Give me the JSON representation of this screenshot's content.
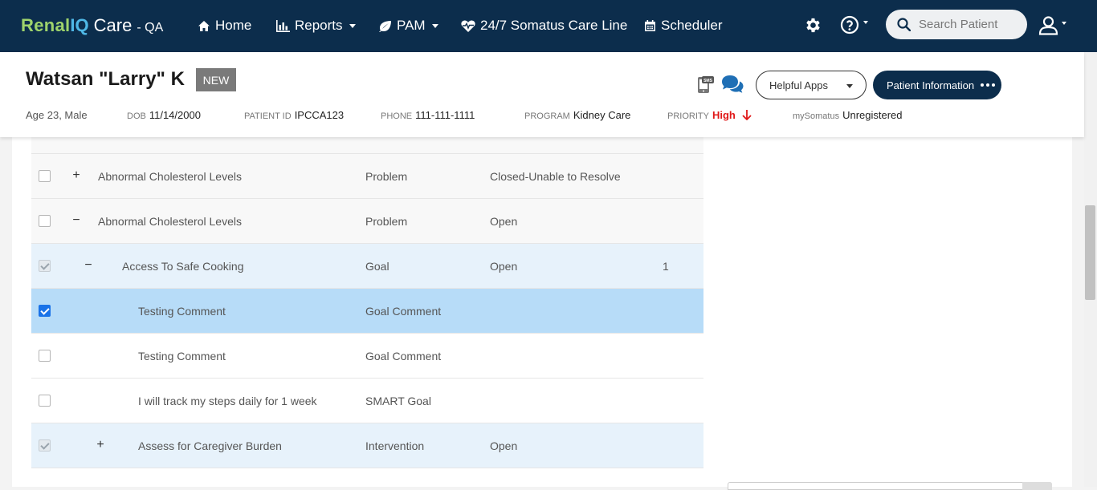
{
  "brand": {
    "renal": "Renal",
    "iq": "IQ",
    "care": "Care",
    "env": "- QA"
  },
  "nav": {
    "home": "Home",
    "reports": "Reports",
    "pam": "PAM",
    "careline": "24/7 Somatus Care Line",
    "scheduler": "Scheduler"
  },
  "search": {
    "placeholder": "Search Patient"
  },
  "patient": {
    "name": "Watsan \"Larry\" K",
    "badge": "NEW",
    "age": "Age 23, Male",
    "dob_label": "DOB",
    "dob": "11/14/2000",
    "id_label": "PATIENT ID",
    "id": "IPCCA123",
    "phone_label": "PHONE",
    "phone": "111-111-1111",
    "program_label": "PROGRAM",
    "program": "Kidney Care",
    "priority_label": "PRIORITY",
    "priority": "High",
    "mysomatus_label": "mySomatus",
    "mysomatus": "Unregistered"
  },
  "actions": {
    "helpful_apps": "Helpful Apps",
    "patient_info": "Patient Information"
  },
  "rows": [
    {
      "name": "Abnormal Cholesterol Levels",
      "type": "Problem",
      "status": "Closed-Unable to Resolve",
      "count": ""
    },
    {
      "name": "Abnormal Cholesterol Levels",
      "type": "Problem",
      "status": "Open",
      "count": ""
    },
    {
      "name": "Access To Safe Cooking",
      "type": "Goal",
      "status": "Open",
      "count": "1"
    },
    {
      "name": "Testing Comment",
      "type": "Goal Comment",
      "status": "",
      "count": ""
    },
    {
      "name": "Testing Comment",
      "type": "Goal Comment",
      "status": "",
      "count": ""
    },
    {
      "name": "I will track my steps daily for 1 week",
      "type": "SMART Goal",
      "status": "",
      "count": ""
    },
    {
      "name": "Assess for Caregiver Burden",
      "type": "Intervention",
      "status": "Open",
      "count": ""
    }
  ],
  "colors": {
    "navbar": "#0c2d4c",
    "accent": "#1a73e8",
    "priority": "#e01818"
  }
}
